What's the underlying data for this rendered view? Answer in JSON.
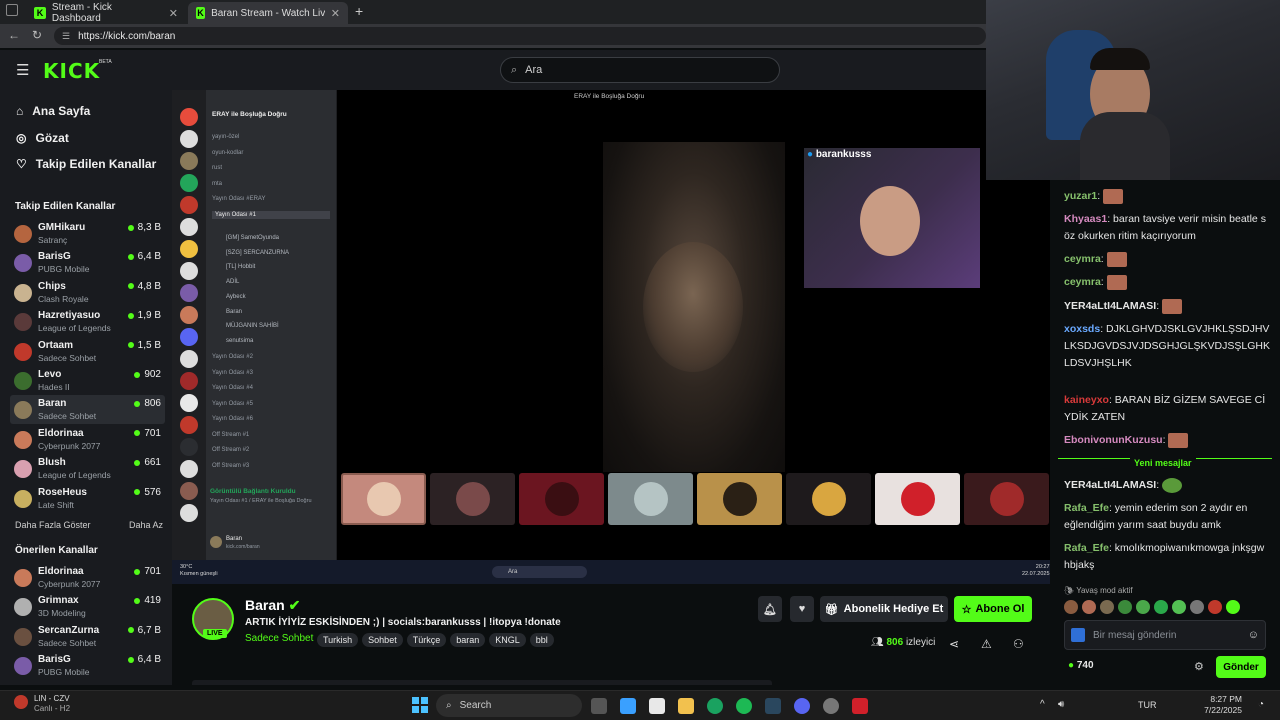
{
  "browser": {
    "tabs": [
      {
        "title": "Stream - Kick Dashboard",
        "active": false
      },
      {
        "title": "Baran Stream - Watch Live on Kic",
        "active": true
      }
    ],
    "url": "https://kick.com/baran"
  },
  "kick": {
    "logo": "KICK",
    "beta": "BETA",
    "search_placeholder": "Ara",
    "nav": [
      {
        "label": "Ana Sayfa",
        "icon": "home-icon"
      },
      {
        "label": "Gözat",
        "icon": "compass-icon"
      },
      {
        "label": "Takip Edilen Kanallar",
        "icon": "heart-icon"
      }
    ],
    "followed_title": "Takip Edilen Kanallar",
    "followed": [
      {
        "name": "GMHikaru",
        "cat": "Satranç",
        "viewers": "8,3 B",
        "color": "#b5653f"
      },
      {
        "name": "BarisG",
        "cat": "PUBG Mobile",
        "viewers": "6,4 B",
        "color": "#7a5ca8"
      },
      {
        "name": "Chips",
        "cat": "Clash Royale",
        "viewers": "4,8 B",
        "color": "#c9b390"
      },
      {
        "name": "Hazretiyasuo",
        "cat": "League of Legends",
        "viewers": "1,9 B",
        "color": "#5a3a3a"
      },
      {
        "name": "Ortaam",
        "cat": "Sadece Sohbet",
        "viewers": "1,5 B",
        "color": "#c0392b"
      },
      {
        "name": "Levo",
        "cat": "Hades II",
        "viewers": "902",
        "color": "#3b6d2e"
      },
      {
        "name": "Baran",
        "cat": "Sadece Sohbet",
        "viewers": "806",
        "color": "#8a7a5a"
      },
      {
        "name": "Eldorinaa",
        "cat": "Cyberpunk 2077",
        "viewers": "701",
        "color": "#c97a5a"
      },
      {
        "name": "Blush",
        "cat": "League of Legends",
        "viewers": "661",
        "color": "#d9a0b0"
      },
      {
        "name": "RoseHeus",
        "cat": "Late Shift",
        "viewers": "576",
        "color": "#c8b060"
      }
    ],
    "show_more": "Daha Fazla Göster",
    "show_less": "Daha Az",
    "recommended_title": "Önerilen Kanallar",
    "recommended": [
      {
        "name": "Eldorinaa",
        "cat": "Cyberpunk 2077",
        "viewers": "701",
        "color": "#c97a5a"
      },
      {
        "name": "Grimnax",
        "cat": "3D Modeling",
        "viewers": "419",
        "color": "#b0b0b0"
      },
      {
        "name": "SercanZurna",
        "cat": "Sadece Sohbet",
        "viewers": "6,7 B",
        "color": "#6a5040"
      },
      {
        "name": "BarisG",
        "cat": "PUBG Mobile",
        "viewers": "6,4 B",
        "color": "#7a5ca8"
      }
    ]
  },
  "discord": {
    "server": "ERAY ile Boşluğa Doğru",
    "window_title": "ERAY ile Boşluğa Doğru",
    "channels": [
      "yayın-özel",
      "oyun-kodlar",
      "rust",
      "mta",
      "Yayın Odası #ERAY",
      "Yayın Odası #1",
      "Yayın Odası #2",
      "Yayın Odası #3",
      "Yayın Odası #4",
      "Yayın Odası #5",
      "Yayın Odası #6",
      "Off Stream #1",
      "Off Stream #2",
      "Off Stream #3"
    ],
    "members": [
      "[GM] SametOyunda",
      "[SZG] SERCANZURNA",
      "[TL] Hobbit",
      "ADİL",
      "Aybeck",
      "Baran",
      "MÜJGANIN SAHİBİ",
      "senutsima"
    ],
    "voice_status": "Görüntülü Bağlantı Kuruldu",
    "voice_channel": "Yayın Odası #1 / ERAY ile Boşluğa Doğru",
    "user": "Baran",
    "user_sub": "kick.com/baran",
    "cam_label": "barankusss",
    "taskbar_search": "Ara",
    "clock": "20:27",
    "date": "22.07.2025",
    "weather": "30°C",
    "weather_sub": "Kısmen güneşli"
  },
  "stream": {
    "name": "Baran",
    "live": "LIVE",
    "title": "ARTIK İYİYİZ ESKİSİNDEN ;) | socials:barankusss | !itopya !donate",
    "category": "Sadece Sohbet",
    "tags": [
      "Turkish",
      "Sohbet",
      "Türkçe",
      "baran",
      "KNGL",
      "bbl"
    ],
    "gift_label": "Abonelik Hediye Et",
    "subscribe_label": "Abone Ol",
    "viewers": "806",
    "viewers_label": "izleyici"
  },
  "chat": {
    "messages": [
      {
        "user": "yuzar1",
        "color": "#86c06c",
        "text": "",
        "emote": true
      },
      {
        "user": "Khyaas1",
        "color": "#d58abf",
        "text": "baran tavsiye verir misin beatle söz okurken ritim kaçırıyorum",
        "emote": false
      },
      {
        "user": "ceymra",
        "color": "#86c06c",
        "text": "",
        "emote": true
      },
      {
        "user": "ceymra",
        "color": "#86c06c",
        "text": "",
        "emote": true
      },
      {
        "user": "YER4aLtI4LAMASI",
        "color": "#e6e6e6",
        "text": "",
        "emote": true
      },
      {
        "user": "xoxsds",
        "color": "#6aa9ff",
        "text": "DJKLGHVDJSKLGVJHKLŞSDJHVLKSDJGVDSJVJDSGHJGLŞKVDJSŞLGHKLDSVJHŞLHK",
        "emote": false
      },
      {
        "user": "kaineyxo",
        "color": "#d83a3a",
        "text": "BARAN BİZ GİZEM SAVEGE CİYDİK ZATEN",
        "emote": false
      },
      {
        "user": "EbonivonunKuzusu",
        "color": "#d58abf",
        "text": "",
        "emote": true
      }
    ],
    "new_messages": "Yeni mesajlar",
    "messages2": [
      {
        "user": "YER4aLtI4LAMASI",
        "color": "#e6e6e6",
        "text": ""
      },
      {
        "user": "Rafa_Efe",
        "color": "#86c06c",
        "text": "yemin ederim son 2 aydır en eğlendiğim yarım saat buydu amk"
      },
      {
        "user": "Rafa_Efe",
        "color": "#86c06c",
        "text": "kmolıkmopiwanıkmowga jnkşgw hbjakş"
      }
    ],
    "slow_mode": "Yavaş mod aktif",
    "input_placeholder": "Bir mesaj gönderin",
    "points": "740",
    "send_label": "Gönder"
  },
  "windows": {
    "weather_title": "LIN - CZV",
    "weather_sub": "Canlı - H2",
    "search_label": "Search",
    "lang": "TUR",
    "time": "8:27 PM",
    "date": "7/22/2025"
  }
}
